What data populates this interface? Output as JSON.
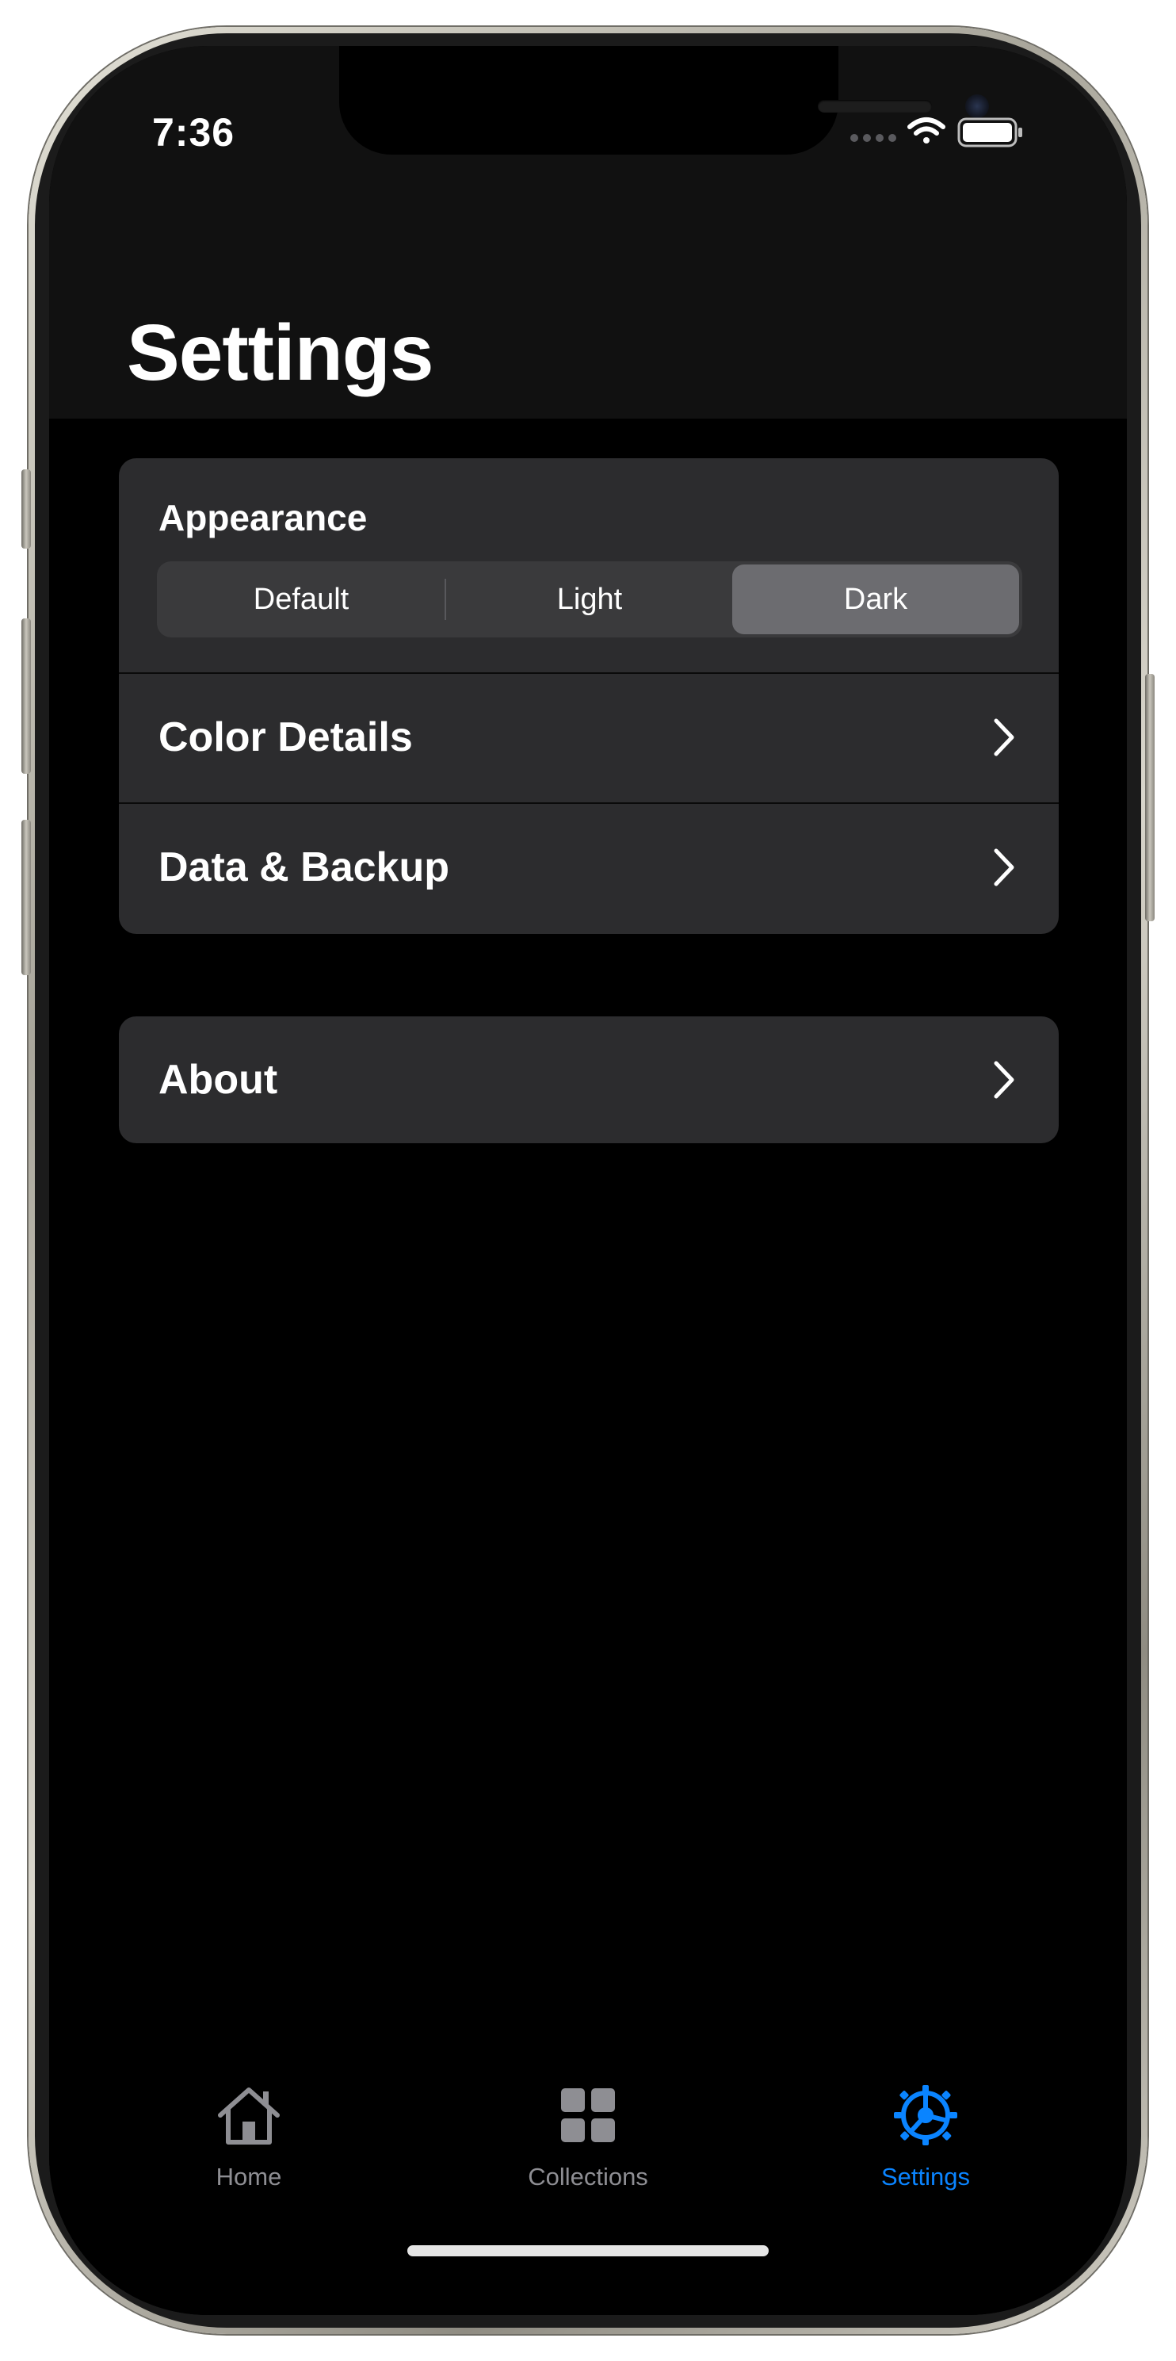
{
  "status_bar": {
    "time": "7:36",
    "icons": [
      "signal-dots-icon",
      "wifi-icon",
      "battery-icon"
    ]
  },
  "header": {
    "title": "Settings"
  },
  "appearance": {
    "label": "Appearance",
    "options": [
      "Default",
      "Light",
      "Dark"
    ],
    "selected": "Dark"
  },
  "rows_group_1": [
    {
      "label": "Color Details",
      "icon": "chevron-right-icon"
    },
    {
      "label": "Data & Backup",
      "icon": "chevron-right-icon"
    }
  ],
  "rows_group_2": [
    {
      "label": "About",
      "icon": "chevron-right-icon"
    }
  ],
  "tabbar": {
    "items": [
      {
        "label": "Home",
        "icon": "home-icon",
        "active": false
      },
      {
        "label": "Collections",
        "icon": "grid-icon",
        "active": false
      },
      {
        "label": "Settings",
        "icon": "gear-icon",
        "active": true
      }
    ],
    "active_color": "#0a84ff",
    "inactive_color": "#8e8e93"
  },
  "colors": {
    "background": "#000000",
    "group_background": "#2c2c2e",
    "segment_selected": "#6c6c70",
    "accent": "#0a84ff"
  }
}
